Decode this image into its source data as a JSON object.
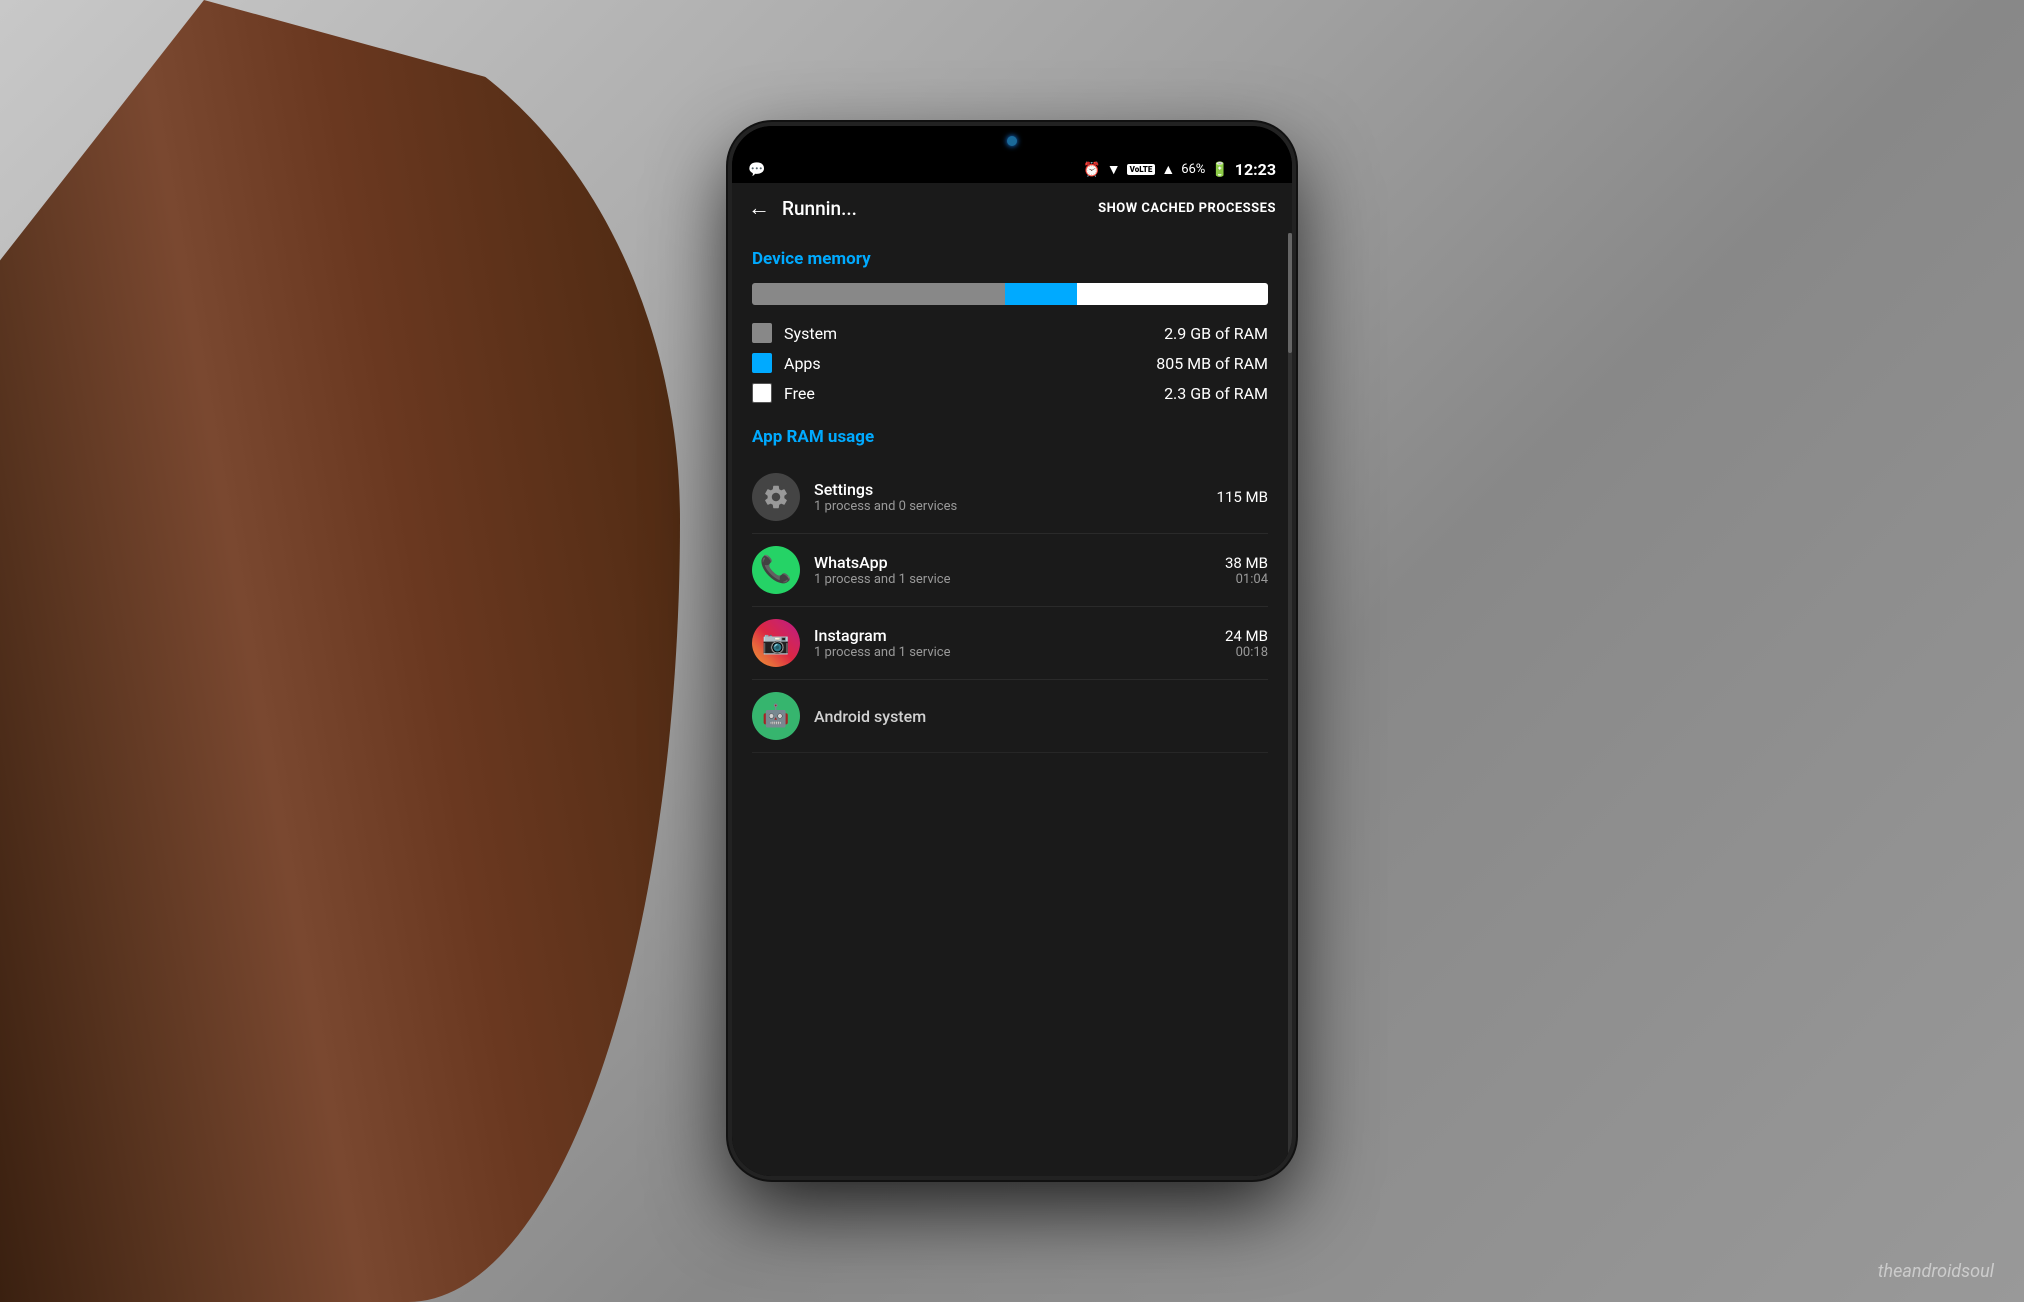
{
  "background": {
    "color": "#a8a8a8"
  },
  "status_bar": {
    "alarm_icon": "⏰",
    "wifi_icon": "▼",
    "volte_label": "VoLTE",
    "signal_icon": "▲",
    "battery_percent": "66%",
    "battery_icon": "🔋",
    "time": "12:23"
  },
  "toolbar": {
    "back_label": "←",
    "title": "Runnin...",
    "show_cached_label": "SHOW CACHED PROCESSES"
  },
  "device_memory": {
    "section_title": "Device memory",
    "bar": {
      "system_percent": 49,
      "apps_percent": 14,
      "free_percent": 37
    },
    "legend": [
      {
        "id": "system",
        "color": "#888",
        "label": "System",
        "value": "2.9 GB of RAM"
      },
      {
        "id": "apps",
        "color": "#00aaff",
        "label": "Apps",
        "value": "805 MB of RAM"
      },
      {
        "id": "free",
        "color": "#ffffff",
        "label": "Free",
        "value": "2.3 GB of RAM"
      }
    ]
  },
  "app_ram_usage": {
    "section_title": "App RAM usage",
    "apps": [
      {
        "id": "settings",
        "name": "Settings",
        "process": "1 process and 0 services",
        "mem_size": "115 MB",
        "mem_time": "",
        "icon_type": "settings"
      },
      {
        "id": "whatsapp",
        "name": "WhatsApp",
        "process": "1 process and 1 service",
        "mem_size": "38 MB",
        "mem_time": "01:04",
        "icon_type": "whatsapp"
      },
      {
        "id": "instagram",
        "name": "Instagram",
        "process": "1 process and 1 service",
        "mem_size": "24 MB",
        "mem_time": "00:18",
        "icon_type": "instagram"
      },
      {
        "id": "android-system",
        "name": "Android system",
        "process": "",
        "mem_size": "",
        "mem_time": "",
        "icon_type": "android"
      }
    ]
  },
  "watermark": "theandroidsoul"
}
